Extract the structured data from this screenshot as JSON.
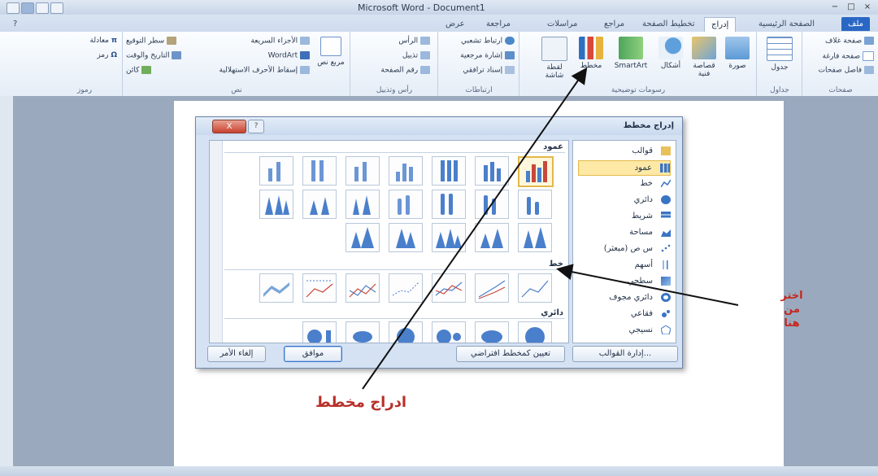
{
  "window": {
    "title": "Microsoft Word - Document1"
  },
  "tabs": {
    "file": "ملف",
    "home": "الصفحة الرئيسية",
    "insert": "إدراج",
    "page_layout": "تخطيط الصفحة",
    "references": "مراجع",
    "mailings": "مراسلات",
    "review": "مراجعة",
    "view": "عرض"
  },
  "ribbon": {
    "pages": {
      "label": "صفحات",
      "items": [
        "صفحة غلاف",
        "صفحة فارغة",
        "فاصل صفحات"
      ]
    },
    "tables": {
      "label": "جداول",
      "table": "جدول"
    },
    "illustrations": {
      "label": "رسومات توضيحية",
      "picture": "صورة",
      "clipart": "قصاصة فنية",
      "shapes": "أشكال",
      "smartart": "SmartArt",
      "chart": "مخطط",
      "screenshot": "لقطة شاشة"
    },
    "links": {
      "label": "ارتباطات",
      "items": [
        "ارتباط تشعبي",
        "إشارة مرجعية",
        "إسناد ترافقي"
      ]
    },
    "header_footer": {
      "label": "رأس وتذييل",
      "items": [
        "الرأس",
        "تذييل",
        "رقم الصفحة"
      ]
    },
    "text": {
      "label": "نص",
      "textbox": "مربع نص",
      "items": [
        "الأجزاء السريعة",
        "WordArt",
        "إسقاط الأحرف الاستهلالية",
        "سطر التوقيع",
        "التاريخ والوقت",
        "كائن"
      ]
    },
    "symbols": {
      "label": "رموز",
      "items": [
        "معادلة",
        "رمز"
      ]
    }
  },
  "dialog": {
    "title": "إدراج مخطط",
    "close_label": "X",
    "types": [
      {
        "label": "قوالب",
        "icon": "folder-icon"
      },
      {
        "label": "عمود",
        "icon": "column-chart-icon",
        "selected": true
      },
      {
        "label": "خط",
        "icon": "line-chart-icon"
      },
      {
        "label": "دائري",
        "icon": "pie-chart-icon"
      },
      {
        "label": "شريط",
        "icon": "bar-chart-icon"
      },
      {
        "label": "مساحة",
        "icon": "area-chart-icon"
      },
      {
        "label": "س ص (مبعثر)",
        "icon": "scatter-chart-icon"
      },
      {
        "label": "أسهم",
        "icon": "stock-chart-icon"
      },
      {
        "label": "سطحي",
        "icon": "surface-chart-icon"
      },
      {
        "label": "دائري مجوف",
        "icon": "doughnut-chart-icon"
      },
      {
        "label": "فقاعي",
        "icon": "bubble-chart-icon"
      },
      {
        "label": "نسيجي",
        "icon": "radar-chart-icon"
      }
    ],
    "sections": {
      "column": "عمود",
      "line": "خط",
      "pie": "دائري"
    },
    "buttons": {
      "manage_templates": "إدارة القوالب...",
      "set_default": "تعيين كمخطط افتراضي",
      "ok": "موافق",
      "cancel": "إلغاء الأمر"
    }
  },
  "annotations": {
    "choose_here": [
      "اختر",
      "من",
      "هنا"
    ],
    "insert_chart": "ادراج مخطط"
  },
  "colors": {
    "accent": "#2a67c4",
    "annotation_red": "#c6261e",
    "selection_gold": "#e3b84a"
  }
}
